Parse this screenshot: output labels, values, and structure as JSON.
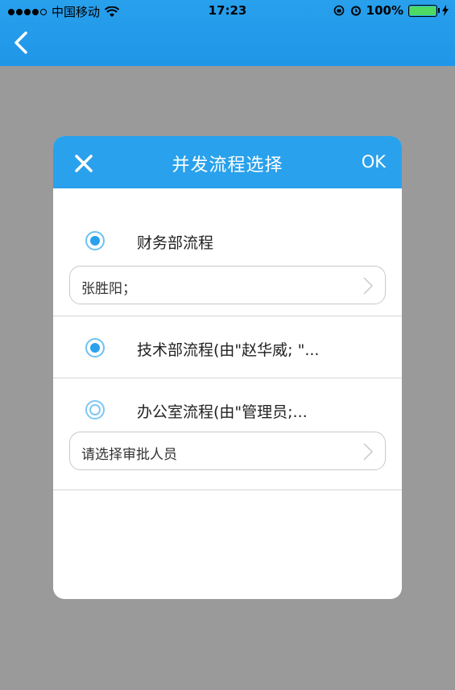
{
  "status": {
    "carrier": "中国移动",
    "time": "17:23",
    "battery_pct": "100%"
  },
  "dialog": {
    "title": "并发流程选择",
    "ok": "OK",
    "options": [
      {
        "label": "财务部流程",
        "selected": true,
        "picker_value": "张胜阳；"
      },
      {
        "label": "技术部流程(由\"赵华威; \"...",
        "selected": true
      },
      {
        "label": "办公室流程(由\"管理员;...",
        "selected": false,
        "picker_value": "请选择审批人员"
      }
    ]
  },
  "colors": {
    "accent": "#2aa1ec",
    "overlay": "#9a9a9a"
  }
}
